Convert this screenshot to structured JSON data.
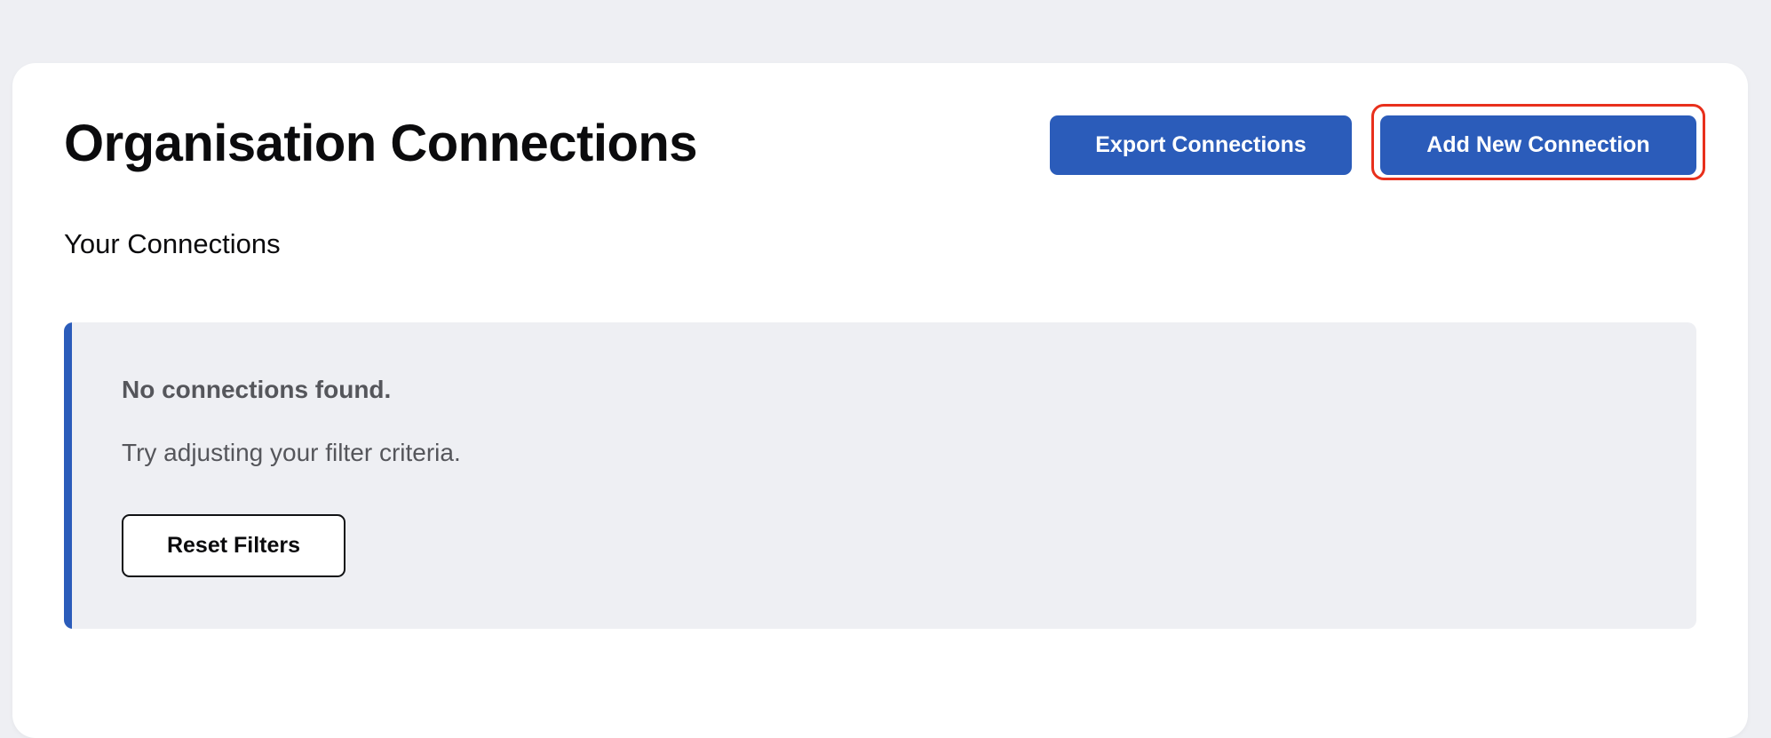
{
  "header": {
    "title": "Organisation Connections",
    "export_label": "Export Connections",
    "add_label": "Add New Connection"
  },
  "section": {
    "heading": "Your Connections"
  },
  "empty_state": {
    "title": "No connections found.",
    "description": "Try adjusting your filter criteria.",
    "reset_label": "Reset Filters"
  },
  "colors": {
    "primary": "#2b5cba",
    "highlight": "#e8301c",
    "page_background": "#eeeff3"
  }
}
